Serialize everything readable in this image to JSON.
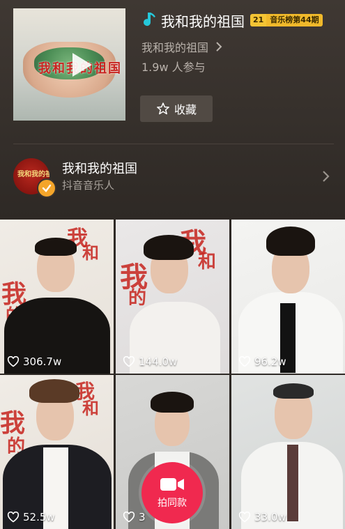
{
  "song": {
    "title": "我和我的祖国",
    "rank_number": "21",
    "rank_text": "音乐榜第44期",
    "album": "我和我的祖国",
    "participants": "1.9w 人参与",
    "collect_label": "收藏",
    "cover_text": "我和我的祖国"
  },
  "artist": {
    "name": "我和我的祖国",
    "subtitle": "抖音音乐人"
  },
  "videos": [
    {
      "likes": "306.7w"
    },
    {
      "likes": "144.0w"
    },
    {
      "likes": "96.2w"
    },
    {
      "likes": "52.5w"
    },
    {
      "likes": "3"
    },
    {
      "likes": "33.0w"
    }
  ],
  "shoot_button": {
    "label": "拍同款"
  },
  "colors": {
    "accent_pink": "#f0294f",
    "rank_gold": "#f4c434",
    "verified_orange": "#f4a52a",
    "note_cyan": "#25c7d9"
  },
  "icons": [
    "music-note-icon",
    "star-icon",
    "chevron-right-icon",
    "heart-icon",
    "camera-icon",
    "check-icon",
    "play-icon"
  ]
}
